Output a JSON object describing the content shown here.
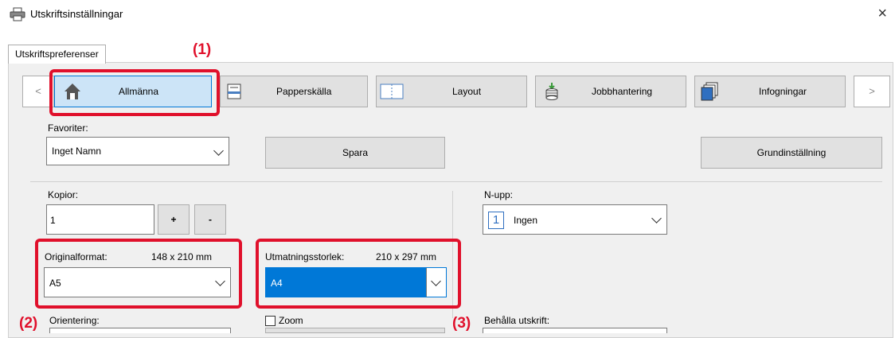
{
  "window": {
    "title": "Utskriftsinställningar",
    "close_glyph": "×"
  },
  "tab": {
    "label": "Utskriftspreferenser"
  },
  "ribbon": {
    "prev": "<",
    "next": ">",
    "items": [
      {
        "label": "Allmänna",
        "icon": "home-icon"
      },
      {
        "label": "Papperskälla",
        "icon": "paper-tray-icon"
      },
      {
        "label": "Layout",
        "icon": "layout-icon",
        "icon_text": "1|2"
      },
      {
        "label": "Jobbhantering",
        "icon": "job-stack-icon"
      },
      {
        "label": "Infogningar",
        "icon": "inserts-icon"
      }
    ]
  },
  "favorites": {
    "label": "Favoriter:",
    "value": "Inget Namn",
    "save": "Spara",
    "defaults": "Grundinställning"
  },
  "copies": {
    "label": "Kopior:",
    "value": "1",
    "plus": "+",
    "minus": "-"
  },
  "nup": {
    "label": "N-upp:",
    "icon_text": "1",
    "value": "Ingen"
  },
  "original": {
    "label": "Originalformat:",
    "size": "148 x 210 mm",
    "value": "A5"
  },
  "output": {
    "label": "Utmatningsstorlek:",
    "size": "210 x 297 mm",
    "value": "A4"
  },
  "orientation": {
    "label": "Orientering:"
  },
  "zoom": {
    "label": "Zoom"
  },
  "retain": {
    "label": "Behålla utskrift:"
  },
  "annotations": {
    "n1": "(1)",
    "n2": "(2)",
    "n3": "(3)"
  },
  "colors": {
    "accent": "#0078d7",
    "highlight": "#e0102b",
    "selected_bg": "#cce4f7"
  }
}
